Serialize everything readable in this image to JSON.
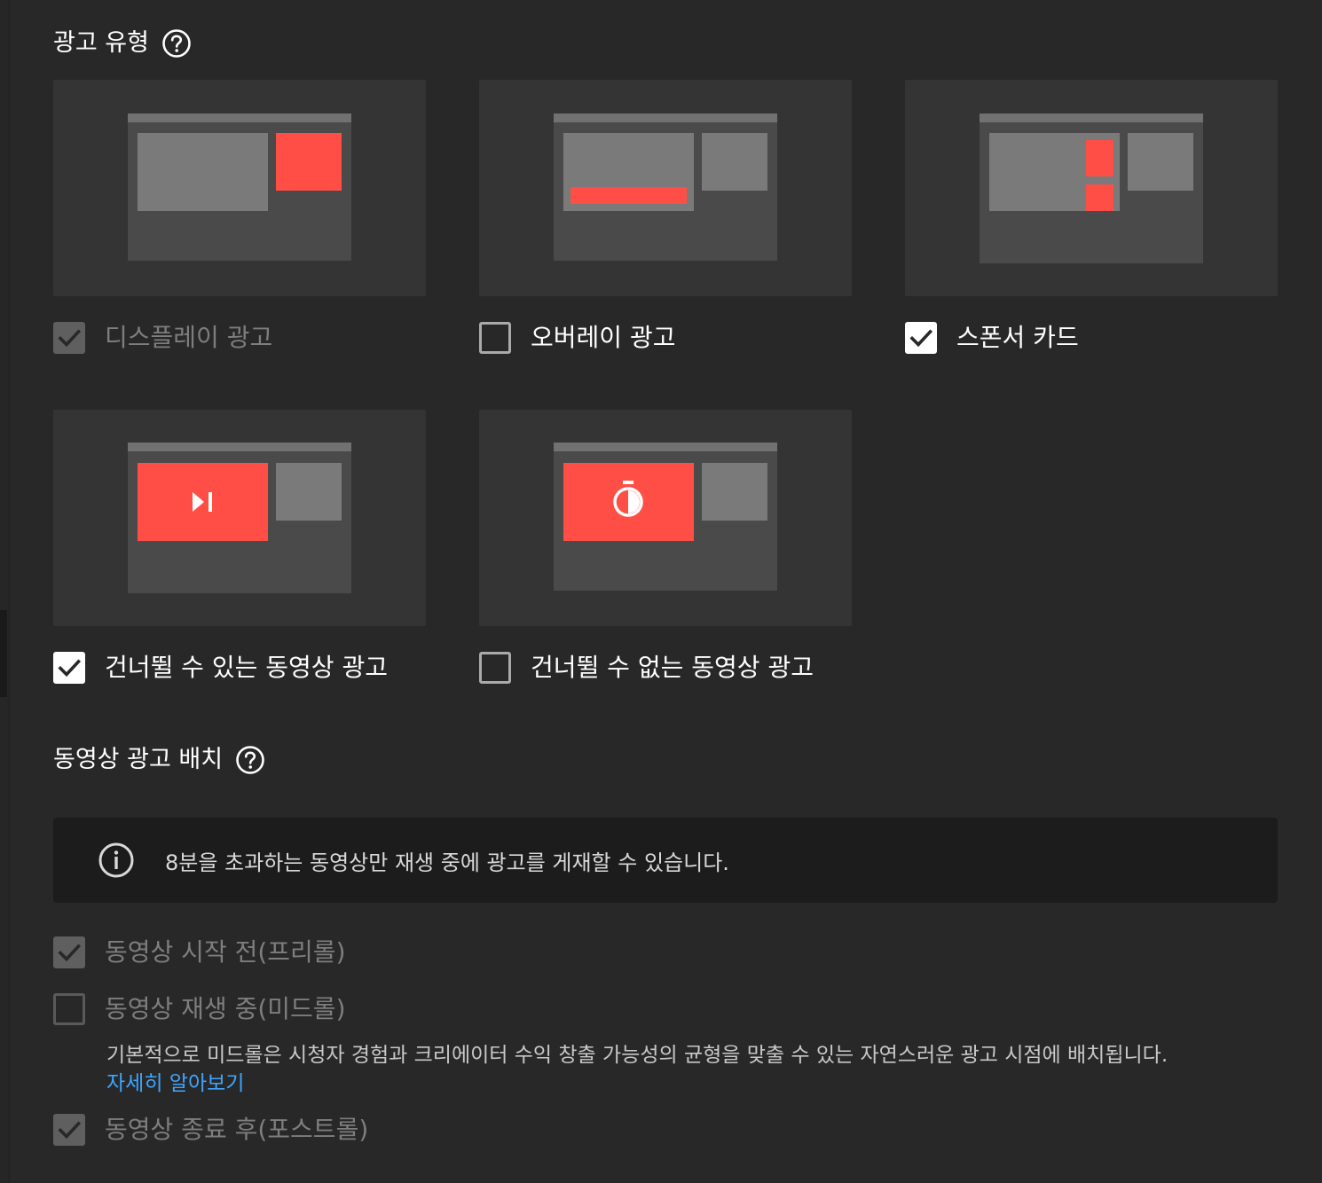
{
  "ad_types": {
    "title": "광고 유형",
    "help_icon": "help-circle-icon",
    "options": [
      {
        "label": "디스플레이 광고",
        "state": "checked-disabled"
      },
      {
        "label": "오버레이 광고",
        "state": "unchecked"
      },
      {
        "label": "스폰서 카드",
        "state": "checked"
      },
      {
        "label": "건너뛸 수 있는 동영상 광고",
        "state": "checked"
      },
      {
        "label": "건너뛸 수 없는 동영상 광고",
        "state": "unchecked"
      }
    ]
  },
  "video_placement": {
    "title": "동영상 광고 배치",
    "help_icon": "help-circle-icon",
    "info": {
      "icon": "info-icon",
      "text": "8분을 초과하는 동영상만 재생 중에 광고를 게재할 수 있습니다."
    },
    "options": [
      {
        "label": "동영상 시작 전(프리롤)",
        "state": "checked-disabled"
      },
      {
        "label": "동영상 재생 중(미드롤)",
        "state": "unchecked-disabled"
      },
      {
        "label": "동영상 종료 후(포스트롤)",
        "state": "checked-disabled"
      }
    ],
    "midroll_description": "기본적으로 미드롤은 시청자 경험과 크리에이터 수익 창출 가능성의 균형을 맞출 수 있는 자연스러운 광고 시점에 배치됩니다.",
    "learn_more": "자세히 알아보기"
  },
  "colors": {
    "background": "#282828",
    "card": "#343434",
    "accent_red": "#ff4e45",
    "link_blue": "#3ea6ff"
  }
}
